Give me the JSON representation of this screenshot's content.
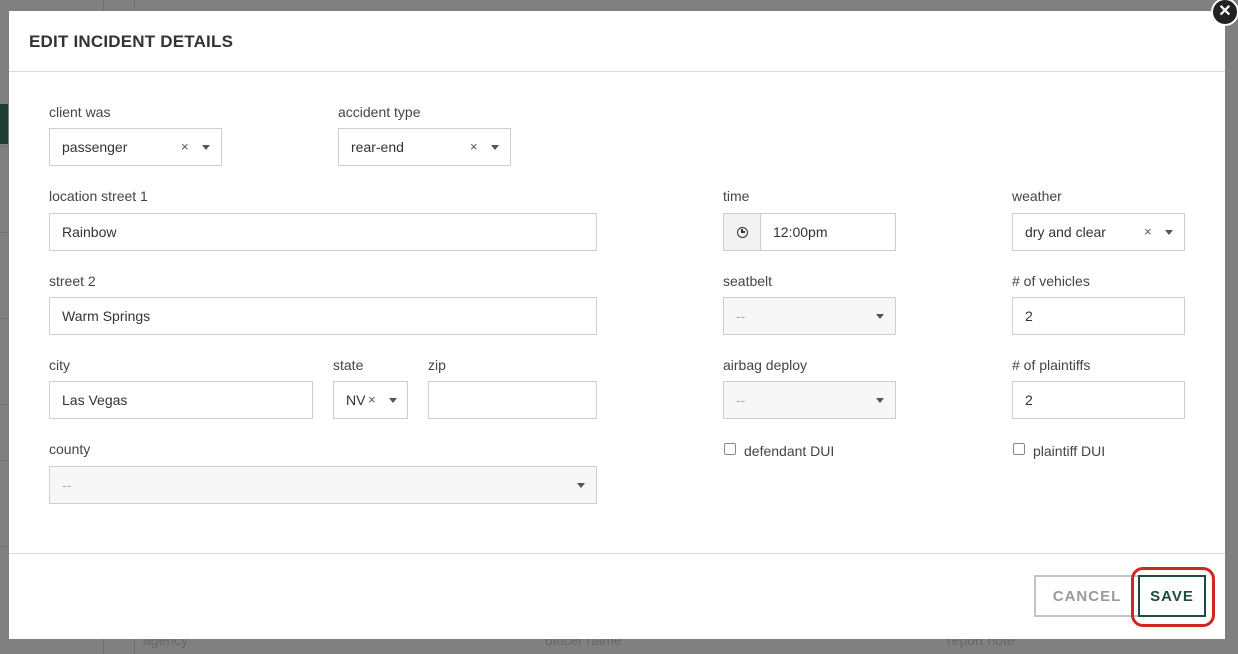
{
  "modal": {
    "title": "EDIT INCIDENT DETAILS",
    "close_icon": "close-icon"
  },
  "background": {
    "labels": [
      "agency",
      "officer name",
      "report note"
    ]
  },
  "form": {
    "client_was": {
      "label": "client was",
      "value": "passenger",
      "clear": "×"
    },
    "accident_type": {
      "label": "accident type",
      "value": "rear-end",
      "clear": "×"
    },
    "location_street_1": {
      "label": "location street 1",
      "value": "Rainbow"
    },
    "street_2": {
      "label": "street 2",
      "value": "Warm Springs"
    },
    "city": {
      "label": "city",
      "value": "Las Vegas"
    },
    "state": {
      "label": "state",
      "value": "NV",
      "clear": "×"
    },
    "zip": {
      "label": "zip",
      "value": ""
    },
    "county": {
      "label": "county",
      "value": "--"
    },
    "time": {
      "label": "time",
      "value": "12:00pm",
      "icon": "clock-icon"
    },
    "weather": {
      "label": "weather",
      "value": "dry and clear",
      "clear": "×"
    },
    "seatbelt": {
      "label": "seatbelt",
      "value": "--"
    },
    "num_vehicles": {
      "label": "# of vehicles",
      "value": "2"
    },
    "airbag_deploy": {
      "label": "airbag deploy",
      "value": "--"
    },
    "num_plaintiffs": {
      "label": "# of plaintiffs",
      "value": "2"
    },
    "defendant_dui": {
      "label": "defendant DUI",
      "checked": false
    },
    "plaintiff_dui": {
      "label": "plaintiff DUI",
      "checked": false
    }
  },
  "footer": {
    "cancel_label": "CANCEL",
    "save_label": "SAVE"
  },
  "colors": {
    "primary": "#1d4d40",
    "highlight": "#d0281e"
  }
}
